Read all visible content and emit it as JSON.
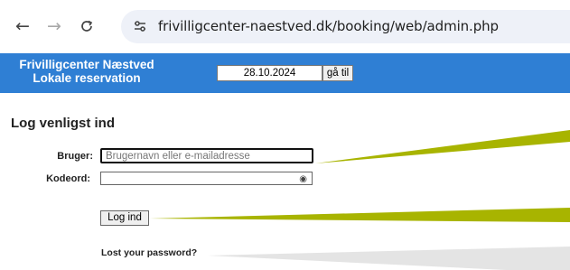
{
  "browser": {
    "url": "frivilligcenter-naestved.dk/booking/web/admin.php"
  },
  "header": {
    "brand_line1": "Frivilligcenter Næstved",
    "brand_line2": "Lokale reservation",
    "date_value": "28.10.2024",
    "go_label": "gå til",
    "accent_color": "#2f7fd4"
  },
  "login": {
    "title": "Log venligst ind",
    "user_label": "Bruger:",
    "user_placeholder": "Brugernavn eller e-mailadresse",
    "password_label": "Kodeord:",
    "submit_label": "Log ind",
    "lost_password": "Lost your password?"
  },
  "icons": {
    "back": "arrow-left-icon",
    "forward": "arrow-right-icon",
    "reload": "reload-icon",
    "site_info": "tune-icon",
    "show_password": "eye-icon"
  }
}
